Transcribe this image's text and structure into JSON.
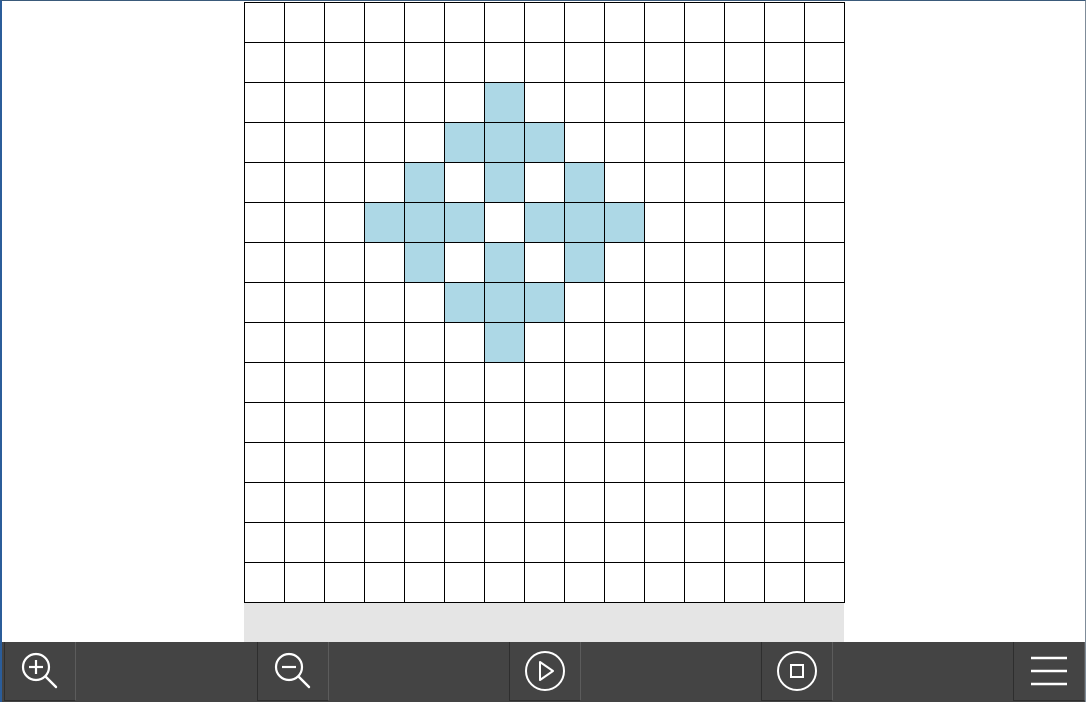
{
  "grid": {
    "rows": 15,
    "cols": 15,
    "alive_color": "#add8e6",
    "dead_color": "#ffffff",
    "line_color": "#000000",
    "alive_cells": [
      [
        2,
        6
      ],
      [
        3,
        5
      ],
      [
        3,
        6
      ],
      [
        3,
        7
      ],
      [
        4,
        4
      ],
      [
        4,
        6
      ],
      [
        4,
        8
      ],
      [
        5,
        3
      ],
      [
        5,
        4
      ],
      [
        5,
        5
      ],
      [
        5,
        7
      ],
      [
        5,
        8
      ],
      [
        5,
        9
      ],
      [
        6,
        4
      ],
      [
        6,
        6
      ],
      [
        6,
        8
      ],
      [
        7,
        5
      ],
      [
        7,
        6
      ],
      [
        7,
        7
      ],
      [
        8,
        6
      ]
    ]
  },
  "toolbar": {
    "background": "#444444",
    "icon_color": "#ffffff",
    "buttons": [
      {
        "name": "zoom-in-button",
        "icon": "zoom-in-icon"
      },
      {
        "name": "zoom-out-button",
        "icon": "zoom-out-icon"
      },
      {
        "name": "play-button",
        "icon": "play-icon"
      },
      {
        "name": "stop-button",
        "icon": "stop-icon"
      },
      {
        "name": "menu-button",
        "icon": "hamburger-menu-icon"
      }
    ]
  }
}
